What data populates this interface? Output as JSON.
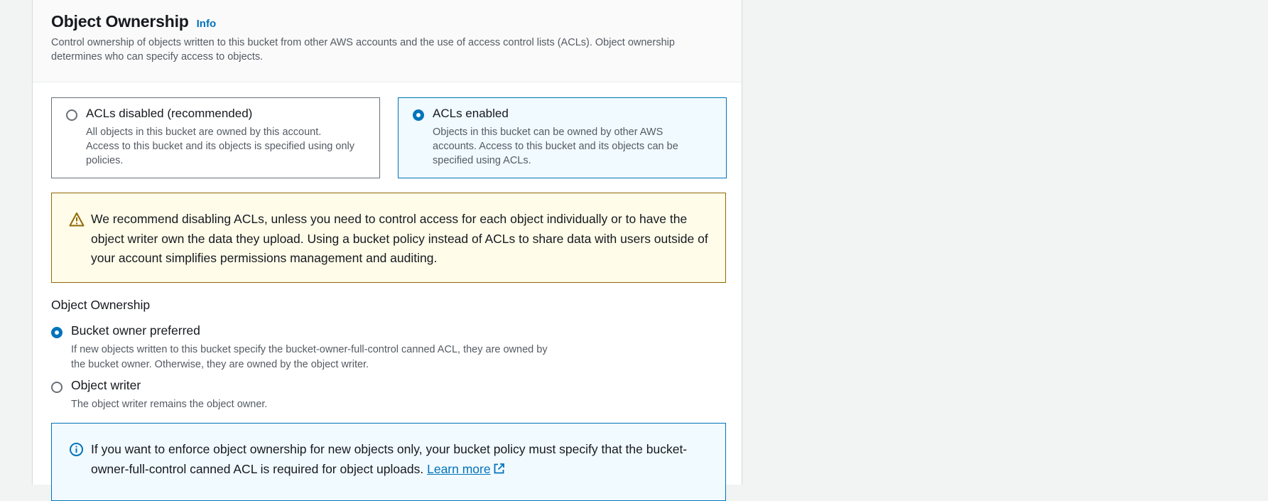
{
  "section": {
    "title": "Object Ownership",
    "info_link": "Info",
    "description": "Control ownership of objects written to this bucket from other AWS accounts and the use of access control lists (ACLs). Object ownership determines who can specify access to objects."
  },
  "acl_tiles": [
    {
      "title": "ACLs disabled (recommended)",
      "description": "All objects in this bucket are owned by this account. Access to this bucket and its objects is specified using only policies.",
      "selected": false
    },
    {
      "title": "ACLs enabled",
      "description": "Objects in this bucket can be owned by other AWS accounts. Access to this bucket and its objects can be specified using ACLs.",
      "selected": true
    }
  ],
  "warning": {
    "icon": "warning-icon",
    "text": "We recommend disabling ACLs, unless you need to control access for each object individually or to have the object writer own the data they upload. Using a bucket policy instead of ACLs to share data with users outside of your account simplifies permissions management and auditing.",
    "color": "#906806"
  },
  "ownership": {
    "label": "Object Ownership",
    "options": [
      {
        "title": "Bucket owner preferred",
        "description": "If new objects written to this bucket specify the bucket-owner-full-control canned ACL, they are owned by the bucket owner. Otherwise, they are owned by the object writer.",
        "selected": true
      },
      {
        "title": "Object writer",
        "description": "The object writer remains the object owner.",
        "selected": false
      }
    ]
  },
  "info_alert": {
    "icon": "info-icon",
    "text": "If you want to enforce object ownership for new objects only, your bucket policy must specify that the bucket-owner-full-control canned ACL is required for object uploads.",
    "link_label": "Learn more",
    "link_icon": "external-link-icon"
  },
  "colors": {
    "accent": "#0073bb",
    "text": "#16191f",
    "secondary_text": "#545b64"
  }
}
